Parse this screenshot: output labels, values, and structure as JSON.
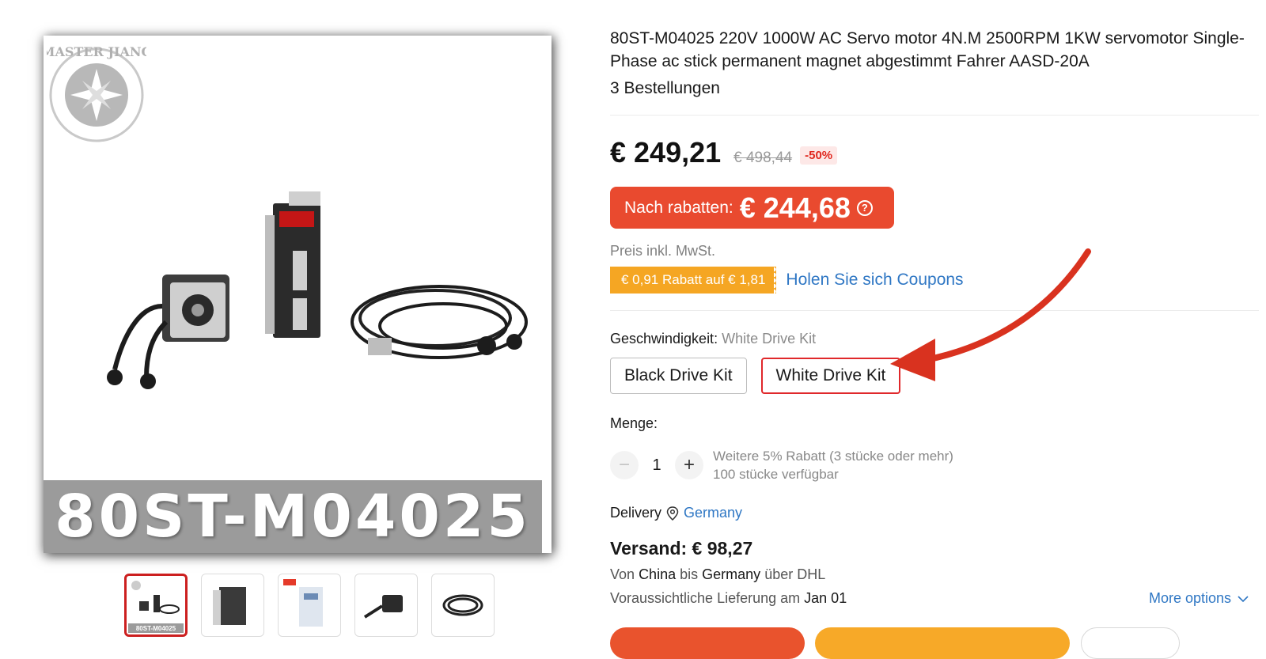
{
  "gallery": {
    "main_image_label": "80ST-M04025",
    "logo_text": "MASTER JIANG",
    "thumbnails": [
      {
        "caption": "80ST-M04025",
        "active": true
      },
      {
        "caption": "",
        "active": false
      },
      {
        "caption": "",
        "active": false
      },
      {
        "caption": "",
        "active": false
      },
      {
        "caption": "",
        "active": false
      }
    ]
  },
  "product": {
    "title": "80ST-M04025 220V 1000W AC Servo motor 4N.M 2500RPM 1KW servomotor Single-Phase ac stick permanent magnet abgestimmt Fahrer AASD-20A",
    "orders": "3 Bestellungen"
  },
  "pricing": {
    "price": "€ 249,21",
    "original_price": "€ 498,44",
    "discount_percent": "-50%",
    "after_discount_label": "Nach rabatten:",
    "after_discount_value": "€ 244,68",
    "help_icon": "?",
    "tax_note": "Preis inkl. MwSt.",
    "coupon_tag": "€ 0,91 Rabatt auf € 1,81",
    "coupon_link": "Holen Sie sich Coupons"
  },
  "variant": {
    "label": "Geschwindigkeit:",
    "selected_value": "White Drive Kit",
    "options": [
      "Black Drive Kit",
      "White Drive Kit"
    ],
    "selected_index": 1
  },
  "quantity": {
    "label": "Menge:",
    "minus": "−",
    "value": "1",
    "plus": "+",
    "bulk_note": "Weitere 5% Rabatt (3 stücke oder mehr)",
    "stock_note": "100 stücke verfügbar"
  },
  "shipping": {
    "delivery_label": "Delivery",
    "country": "Germany",
    "cost": "Versand: € 98,27",
    "route_prefix": "Von",
    "route_from": "China",
    "route_mid": "bis",
    "route_to": "Germany",
    "route_suffix": "über DHL",
    "eta_prefix": "Voraussichtliche Lieferung am",
    "eta_date": "Jan 01",
    "more_options": "More options"
  },
  "colors": {
    "accent_red": "#e94a2f",
    "selected_border": "#e0282b",
    "coupon_orange": "#f5a623",
    "link_blue": "#2f77c4",
    "annotation_arrow": "#d9321f"
  }
}
